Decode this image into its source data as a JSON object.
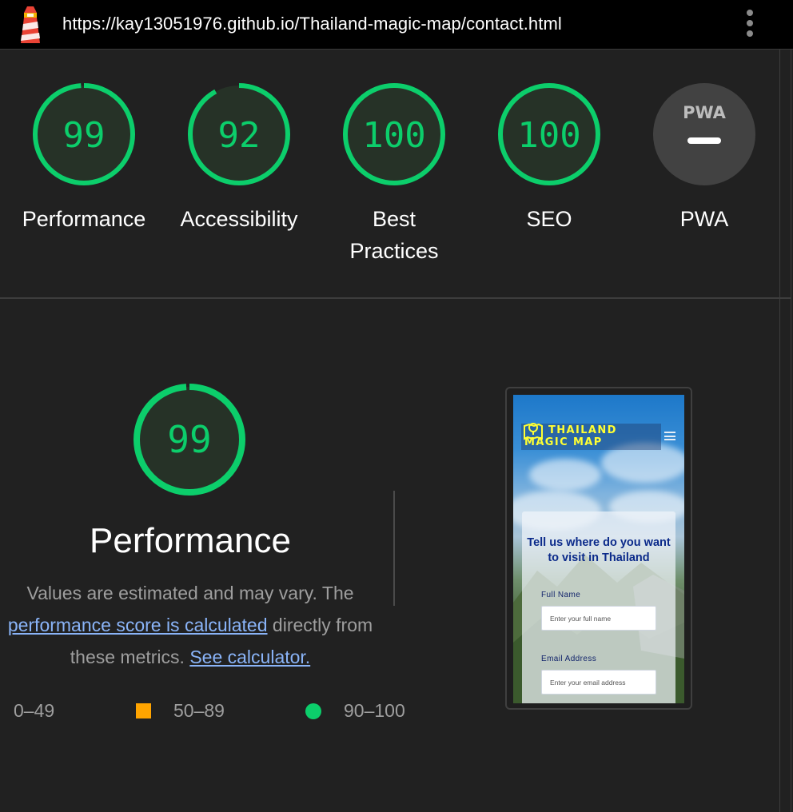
{
  "topbar": {
    "url": "https://kay13051976.github.io/Thailand-magic-map/contact.html",
    "logo_icon": "lighthouse-icon",
    "menu_icon": "more-vert-icon"
  },
  "gauges": [
    {
      "score": "99",
      "label": "Performance",
      "level": 0.99
    },
    {
      "score": "92",
      "label": "Accessibility",
      "level": 0.92
    },
    {
      "score": "100",
      "label": "Best Practices",
      "level": 1.0
    },
    {
      "score": "100",
      "label": "SEO",
      "level": 1.0
    },
    {
      "score": "PWA",
      "label": "PWA",
      "level": null
    }
  ],
  "colors": {
    "pass": "#0cce6b",
    "average": "#ffa400",
    "fail": "#ff4e42",
    "pwa_gray": "#424242"
  },
  "performance": {
    "score": "99",
    "level": 0.99,
    "title": "Performance",
    "desc_prefix": "Values are estimated and may vary. The",
    "desc_link1": "performance score is calculated",
    "desc_mid": "directly from these metrics.",
    "desc_link2": "See calculator."
  },
  "legend": [
    {
      "range": "0–49",
      "shape": "triangle"
    },
    {
      "range": "50–89",
      "shape": "square"
    },
    {
      "range": "90–100",
      "shape": "circle"
    }
  ],
  "preview": {
    "brand_line1": "THAILAND",
    "brand_line2": "MAGIC MAP",
    "heading": "Tell us where do you want to visit in Thailand",
    "field1_label": "Full Name",
    "field1_placeholder": "Enter your full name",
    "field2_label": "Email Address",
    "field2_placeholder": "Enter your email address"
  }
}
